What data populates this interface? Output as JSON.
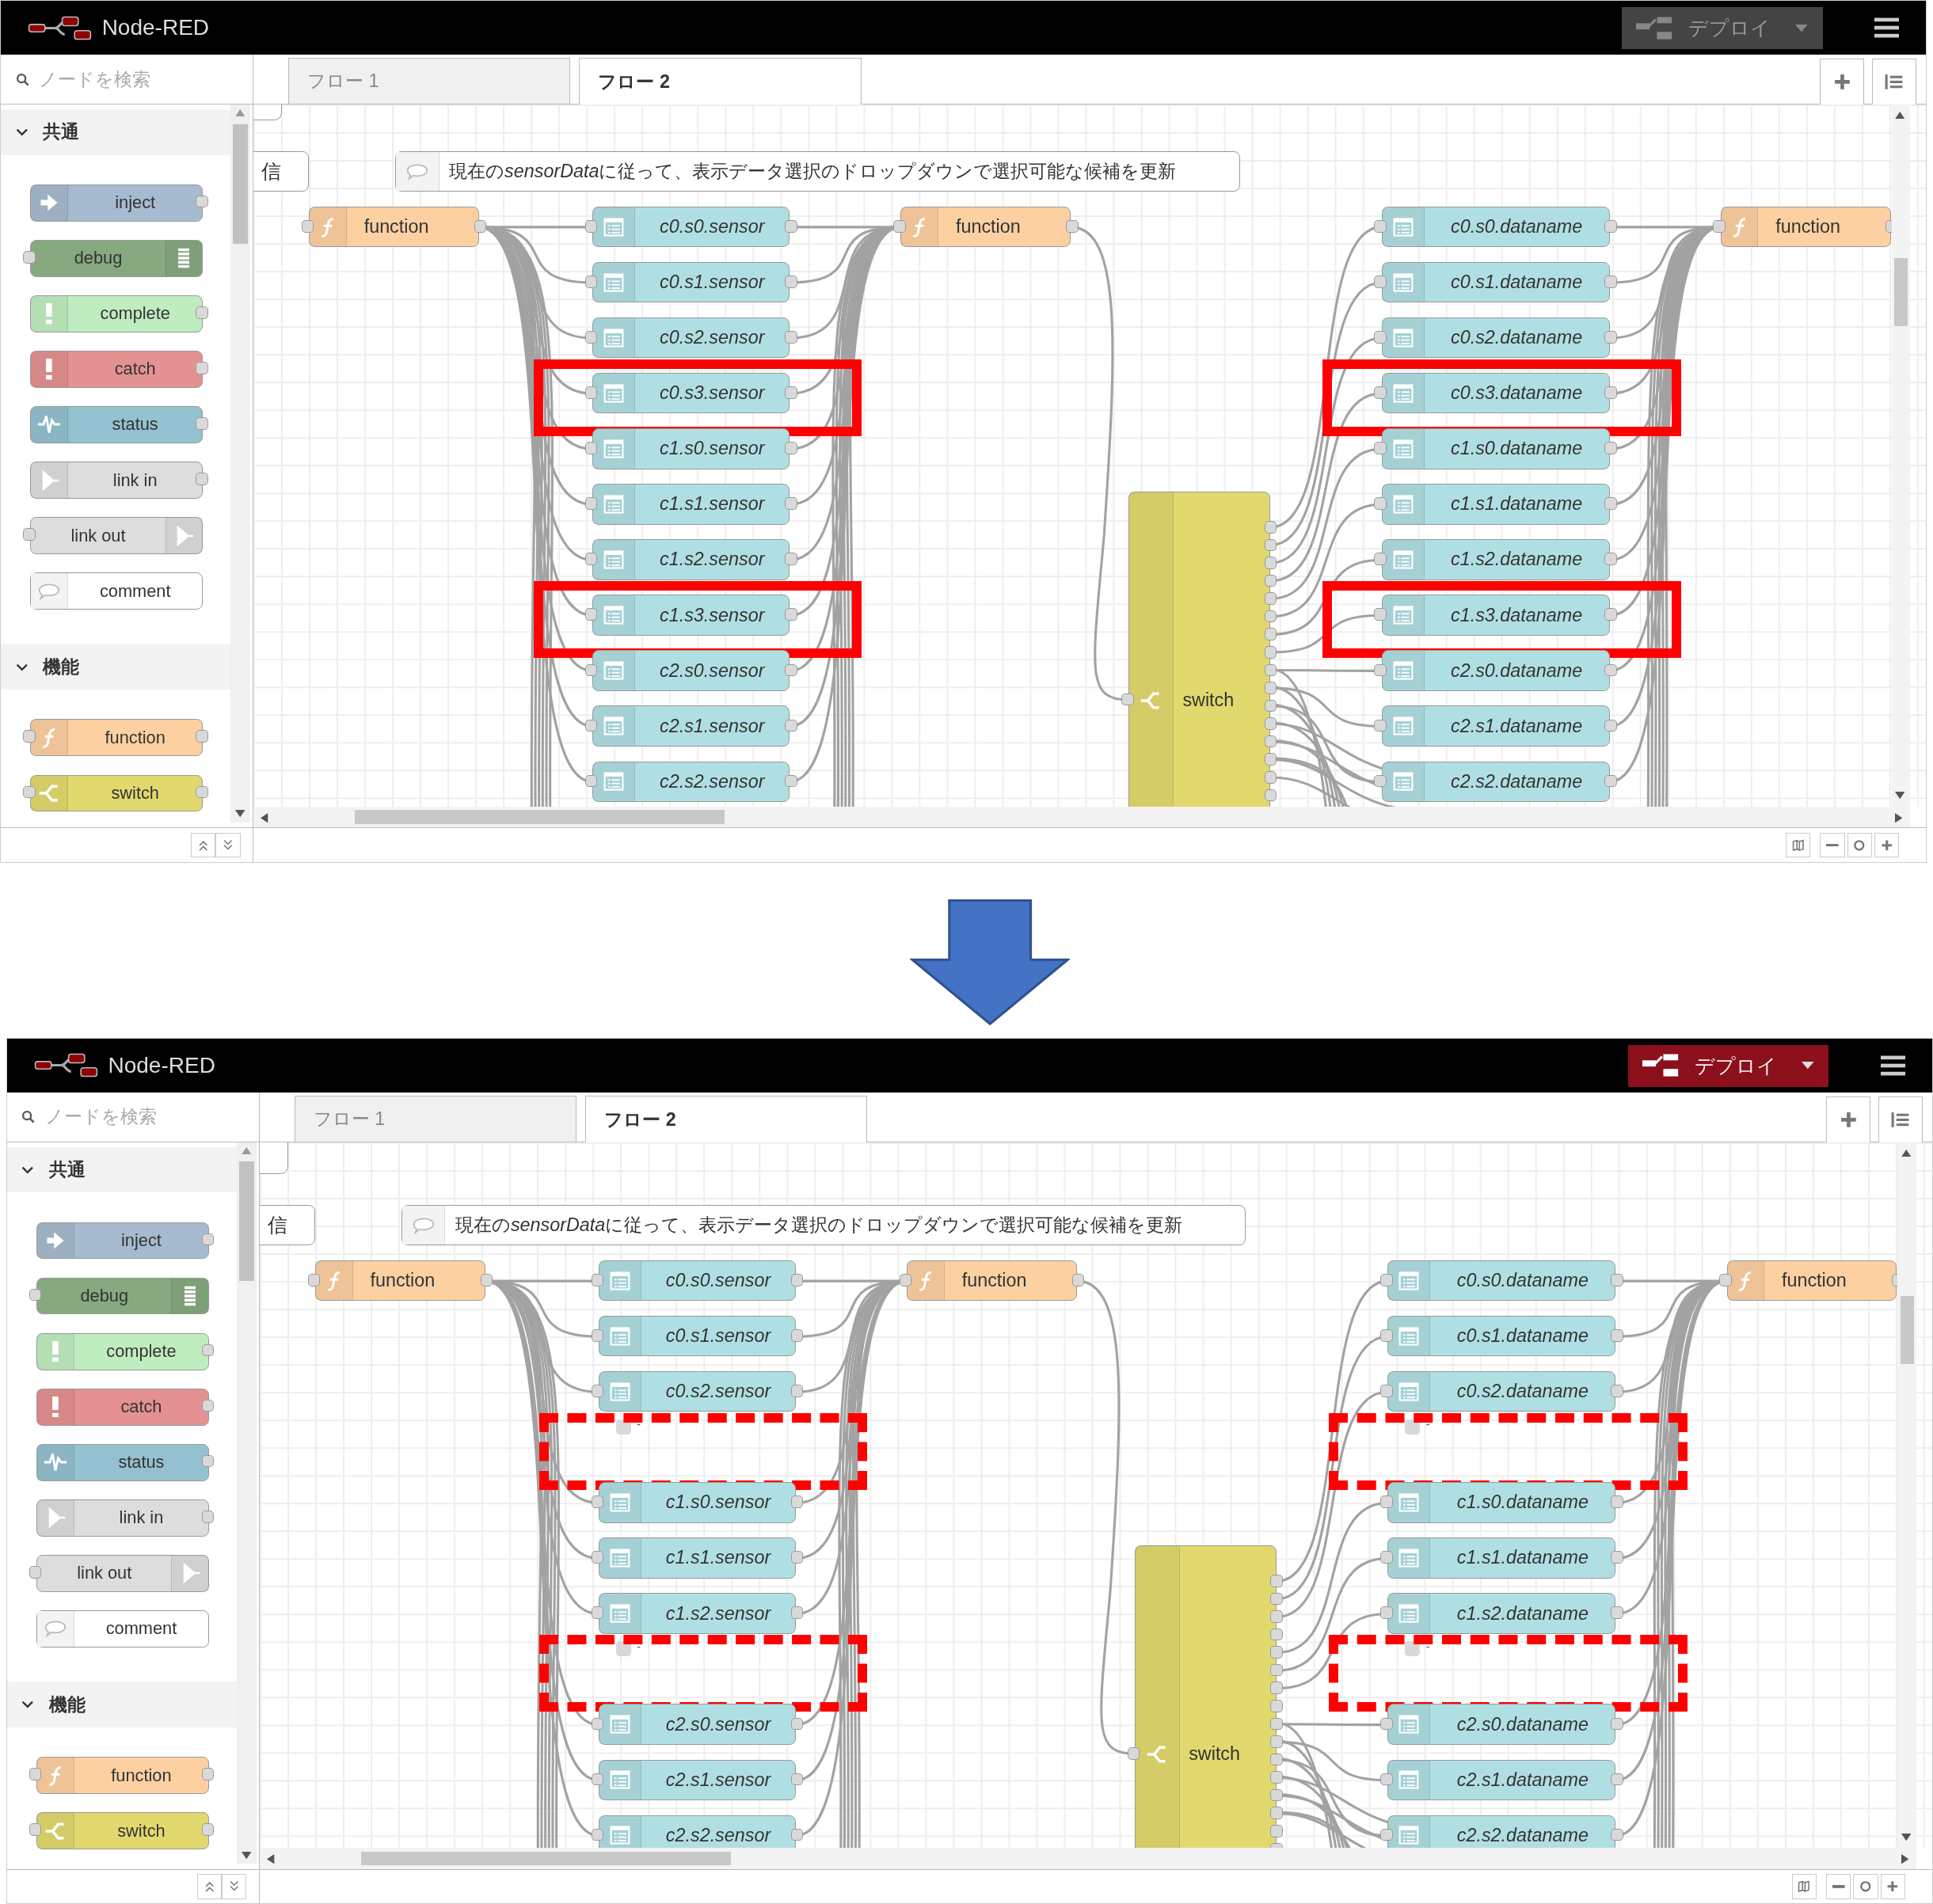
{
  "screens": [
    {
      "header": {
        "title": "Node-RED",
        "deploy": {
          "label": "デプロイ",
          "disabled": true
        }
      },
      "palette": {
        "search_placeholder": "ノードを検索",
        "categories": [
          {
            "label": "共通",
            "expanded": true,
            "nodes": [
              {
                "kind": "inject",
                "label": "inject"
              },
              {
                "kind": "debug",
                "label": "debug"
              },
              {
                "kind": "complete",
                "label": "complete"
              },
              {
                "kind": "catch",
                "label": "catch"
              },
              {
                "kind": "status",
                "label": "status"
              },
              {
                "kind": "link_in",
                "label": "link in"
              },
              {
                "kind": "link_out",
                "label": "link out"
              },
              {
                "kind": "comment",
                "label": "comment"
              }
            ]
          },
          {
            "label": "機能",
            "expanded": true,
            "nodes": [
              {
                "kind": "function",
                "label": "function"
              },
              {
                "kind": "switch",
                "label": "switch"
              }
            ]
          }
        ]
      },
      "tabs": [
        {
          "label": "フロー 1",
          "selected": false
        },
        {
          "label": "フロー 2",
          "selected": true
        }
      ],
      "canvas": {
        "edge_node": {
          "label": "信"
        },
        "comment": {
          "before": "現在の",
          "italic": "sensorData",
          "after": "に従って、表示データ選択のドロップダウンで選択可能な候補を更新"
        },
        "functions": [
          {
            "label": "function"
          },
          {
            "label": "function"
          },
          {
            "label": "function"
          }
        ],
        "switch": {
          "label": "switch"
        },
        "dashed_highlights": false,
        "sensor_column": [
          {
            "kind": "node",
            "label": "c0.s0.sensor",
            "highlighted": false
          },
          {
            "kind": "node",
            "label": "c0.s1.sensor",
            "highlighted": false
          },
          {
            "kind": "node",
            "label": "c0.s2.sensor",
            "highlighted": false
          },
          {
            "kind": "node",
            "label": "c0.s3.sensor",
            "highlighted": true
          },
          {
            "kind": "node",
            "label": "c1.s0.sensor",
            "highlighted": false
          },
          {
            "kind": "node",
            "label": "c1.s1.sensor",
            "highlighted": false
          },
          {
            "kind": "node",
            "label": "c1.s2.sensor",
            "highlighted": false
          },
          {
            "kind": "node",
            "label": "c1.s3.sensor",
            "highlighted": true
          },
          {
            "kind": "node",
            "label": "c2.s0.sensor",
            "highlighted": false
          },
          {
            "kind": "node",
            "label": "c2.s1.sensor",
            "highlighted": false
          },
          {
            "kind": "node",
            "label": "c2.s2.sensor",
            "highlighted": false
          }
        ],
        "dataname_column": [
          {
            "kind": "node",
            "label": "c0.s0.dataname",
            "highlighted": false
          },
          {
            "kind": "node",
            "label": "c0.s1.dataname",
            "highlighted": false
          },
          {
            "kind": "node",
            "label": "c0.s2.dataname",
            "highlighted": false
          },
          {
            "kind": "node",
            "label": "c0.s3.dataname",
            "highlighted": true
          },
          {
            "kind": "node",
            "label": "c1.s0.dataname",
            "highlighted": false
          },
          {
            "kind": "node",
            "label": "c1.s1.dataname",
            "highlighted": false
          },
          {
            "kind": "node",
            "label": "c1.s2.dataname",
            "highlighted": false
          },
          {
            "kind": "node",
            "label": "c1.s3.dataname",
            "highlighted": true
          },
          {
            "kind": "node",
            "label": "c2.s0.dataname",
            "highlighted": false
          },
          {
            "kind": "node",
            "label": "c2.s1.dataname",
            "highlighted": false
          },
          {
            "kind": "node",
            "label": "c2.s2.dataname",
            "highlighted": false
          }
        ]
      }
    },
    {
      "header": {
        "title": "Node-RED",
        "deploy": {
          "label": "デプロイ",
          "disabled": false
        }
      },
      "palette": {
        "search_placeholder": "ノードを検索",
        "categories": [
          {
            "label": "共通",
            "expanded": true,
            "nodes": [
              {
                "kind": "inject",
                "label": "inject"
              },
              {
                "kind": "debug",
                "label": "debug"
              },
              {
                "kind": "complete",
                "label": "complete"
              },
              {
                "kind": "catch",
                "label": "catch"
              },
              {
                "kind": "status",
                "label": "status"
              },
              {
                "kind": "link_in",
                "label": "link in"
              },
              {
                "kind": "link_out",
                "label": "link out"
              },
              {
                "kind": "comment",
                "label": "comment"
              }
            ]
          },
          {
            "label": "機能",
            "expanded": true,
            "nodes": [
              {
                "kind": "function",
                "label": "function"
              },
              {
                "kind": "switch",
                "label": "switch"
              }
            ]
          }
        ]
      },
      "tabs": [
        {
          "label": "フロー 1",
          "selected": false
        },
        {
          "label": "フロー 2",
          "selected": true
        }
      ],
      "canvas": {
        "edge_node": {
          "label": "信"
        },
        "comment": {
          "before": "現在の",
          "italic": "sensorData",
          "after": "に従って、表示データ選択のドロップダウンで選択可能な候補を更新"
        },
        "functions": [
          {
            "label": "function"
          },
          {
            "label": "function"
          },
          {
            "label": "function"
          }
        ],
        "switch": {
          "label": "switch"
        },
        "dashed_highlights": true,
        "sensor_column": [
          {
            "kind": "node",
            "label": "c0.s0.sensor",
            "highlighted": false
          },
          {
            "kind": "node",
            "label": "c0.s1.sensor",
            "highlighted": false
          },
          {
            "kind": "node",
            "label": "c0.s2.sensor",
            "highlighted": false
          },
          {
            "kind": "stub",
            "label": "-",
            "highlighted": true
          },
          {
            "kind": "node",
            "label": "c1.s0.sensor",
            "highlighted": false
          },
          {
            "kind": "node",
            "label": "c1.s1.sensor",
            "highlighted": false
          },
          {
            "kind": "node",
            "label": "c1.s2.sensor",
            "highlighted": false
          },
          {
            "kind": "stub",
            "label": "-",
            "highlighted": true
          },
          {
            "kind": "node",
            "label": "c2.s0.sensor",
            "highlighted": false
          },
          {
            "kind": "node",
            "label": "c2.s1.sensor",
            "highlighted": false
          },
          {
            "kind": "node",
            "label": "c2.s2.sensor",
            "highlighted": false
          }
        ],
        "dataname_column": [
          {
            "kind": "node",
            "label": "c0.s0.dataname",
            "highlighted": false
          },
          {
            "kind": "node",
            "label": "c0.s1.dataname",
            "highlighted": false
          },
          {
            "kind": "node",
            "label": "c0.s2.dataname",
            "highlighted": false
          },
          {
            "kind": "stub",
            "label": "-",
            "highlighted": true
          },
          {
            "kind": "node",
            "label": "c1.s0.dataname",
            "highlighted": false
          },
          {
            "kind": "node",
            "label": "c1.s1.dataname",
            "highlighted": false
          },
          {
            "kind": "node",
            "label": "c1.s2.dataname",
            "highlighted": false
          },
          {
            "kind": "stub",
            "label": "-",
            "highlighted": true
          },
          {
            "kind": "node",
            "label": "c2.s0.dataname",
            "highlighted": false
          },
          {
            "kind": "node",
            "label": "c2.s1.dataname",
            "highlighted": false
          },
          {
            "kind": "node",
            "label": "c2.s2.dataname",
            "highlighted": false
          }
        ]
      }
    }
  ]
}
